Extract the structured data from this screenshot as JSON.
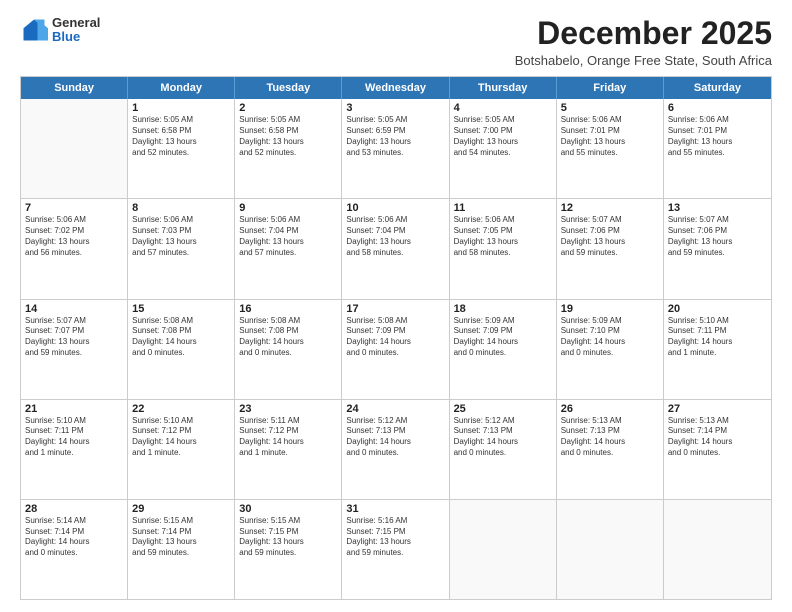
{
  "logo": {
    "general": "General",
    "blue": "Blue"
  },
  "title": "December 2025",
  "subtitle": "Botshabelo, Orange Free State, South Africa",
  "header_days": [
    "Sunday",
    "Monday",
    "Tuesday",
    "Wednesday",
    "Thursday",
    "Friday",
    "Saturday"
  ],
  "weeks": [
    [
      {
        "day": "",
        "lines": []
      },
      {
        "day": "1",
        "lines": [
          "Sunrise: 5:05 AM",
          "Sunset: 6:58 PM",
          "Daylight: 13 hours",
          "and 52 minutes."
        ]
      },
      {
        "day": "2",
        "lines": [
          "Sunrise: 5:05 AM",
          "Sunset: 6:58 PM",
          "Daylight: 13 hours",
          "and 52 minutes."
        ]
      },
      {
        "day": "3",
        "lines": [
          "Sunrise: 5:05 AM",
          "Sunset: 6:59 PM",
          "Daylight: 13 hours",
          "and 53 minutes."
        ]
      },
      {
        "day": "4",
        "lines": [
          "Sunrise: 5:05 AM",
          "Sunset: 7:00 PM",
          "Daylight: 13 hours",
          "and 54 minutes."
        ]
      },
      {
        "day": "5",
        "lines": [
          "Sunrise: 5:06 AM",
          "Sunset: 7:01 PM",
          "Daylight: 13 hours",
          "and 55 minutes."
        ]
      },
      {
        "day": "6",
        "lines": [
          "Sunrise: 5:06 AM",
          "Sunset: 7:01 PM",
          "Daylight: 13 hours",
          "and 55 minutes."
        ]
      }
    ],
    [
      {
        "day": "7",
        "lines": [
          "Sunrise: 5:06 AM",
          "Sunset: 7:02 PM",
          "Daylight: 13 hours",
          "and 56 minutes."
        ]
      },
      {
        "day": "8",
        "lines": [
          "Sunrise: 5:06 AM",
          "Sunset: 7:03 PM",
          "Daylight: 13 hours",
          "and 57 minutes."
        ]
      },
      {
        "day": "9",
        "lines": [
          "Sunrise: 5:06 AM",
          "Sunset: 7:04 PM",
          "Daylight: 13 hours",
          "and 57 minutes."
        ]
      },
      {
        "day": "10",
        "lines": [
          "Sunrise: 5:06 AM",
          "Sunset: 7:04 PM",
          "Daylight: 13 hours",
          "and 58 minutes."
        ]
      },
      {
        "day": "11",
        "lines": [
          "Sunrise: 5:06 AM",
          "Sunset: 7:05 PM",
          "Daylight: 13 hours",
          "and 58 minutes."
        ]
      },
      {
        "day": "12",
        "lines": [
          "Sunrise: 5:07 AM",
          "Sunset: 7:06 PM",
          "Daylight: 13 hours",
          "and 59 minutes."
        ]
      },
      {
        "day": "13",
        "lines": [
          "Sunrise: 5:07 AM",
          "Sunset: 7:06 PM",
          "Daylight: 13 hours",
          "and 59 minutes."
        ]
      }
    ],
    [
      {
        "day": "14",
        "lines": [
          "Sunrise: 5:07 AM",
          "Sunset: 7:07 PM",
          "Daylight: 13 hours",
          "and 59 minutes."
        ]
      },
      {
        "day": "15",
        "lines": [
          "Sunrise: 5:08 AM",
          "Sunset: 7:08 PM",
          "Daylight: 14 hours",
          "and 0 minutes."
        ]
      },
      {
        "day": "16",
        "lines": [
          "Sunrise: 5:08 AM",
          "Sunset: 7:08 PM",
          "Daylight: 14 hours",
          "and 0 minutes."
        ]
      },
      {
        "day": "17",
        "lines": [
          "Sunrise: 5:08 AM",
          "Sunset: 7:09 PM",
          "Daylight: 14 hours",
          "and 0 minutes."
        ]
      },
      {
        "day": "18",
        "lines": [
          "Sunrise: 5:09 AM",
          "Sunset: 7:09 PM",
          "Daylight: 14 hours",
          "and 0 minutes."
        ]
      },
      {
        "day": "19",
        "lines": [
          "Sunrise: 5:09 AM",
          "Sunset: 7:10 PM",
          "Daylight: 14 hours",
          "and 0 minutes."
        ]
      },
      {
        "day": "20",
        "lines": [
          "Sunrise: 5:10 AM",
          "Sunset: 7:11 PM",
          "Daylight: 14 hours",
          "and 1 minute."
        ]
      }
    ],
    [
      {
        "day": "21",
        "lines": [
          "Sunrise: 5:10 AM",
          "Sunset: 7:11 PM",
          "Daylight: 14 hours",
          "and 1 minute."
        ]
      },
      {
        "day": "22",
        "lines": [
          "Sunrise: 5:10 AM",
          "Sunset: 7:12 PM",
          "Daylight: 14 hours",
          "and 1 minute."
        ]
      },
      {
        "day": "23",
        "lines": [
          "Sunrise: 5:11 AM",
          "Sunset: 7:12 PM",
          "Daylight: 14 hours",
          "and 1 minute."
        ]
      },
      {
        "day": "24",
        "lines": [
          "Sunrise: 5:12 AM",
          "Sunset: 7:13 PM",
          "Daylight: 14 hours",
          "and 0 minutes."
        ]
      },
      {
        "day": "25",
        "lines": [
          "Sunrise: 5:12 AM",
          "Sunset: 7:13 PM",
          "Daylight: 14 hours",
          "and 0 minutes."
        ]
      },
      {
        "day": "26",
        "lines": [
          "Sunrise: 5:13 AM",
          "Sunset: 7:13 PM",
          "Daylight: 14 hours",
          "and 0 minutes."
        ]
      },
      {
        "day": "27",
        "lines": [
          "Sunrise: 5:13 AM",
          "Sunset: 7:14 PM",
          "Daylight: 14 hours",
          "and 0 minutes."
        ]
      }
    ],
    [
      {
        "day": "28",
        "lines": [
          "Sunrise: 5:14 AM",
          "Sunset: 7:14 PM",
          "Daylight: 14 hours",
          "and 0 minutes."
        ]
      },
      {
        "day": "29",
        "lines": [
          "Sunrise: 5:15 AM",
          "Sunset: 7:14 PM",
          "Daylight: 13 hours",
          "and 59 minutes."
        ]
      },
      {
        "day": "30",
        "lines": [
          "Sunrise: 5:15 AM",
          "Sunset: 7:15 PM",
          "Daylight: 13 hours",
          "and 59 minutes."
        ]
      },
      {
        "day": "31",
        "lines": [
          "Sunrise: 5:16 AM",
          "Sunset: 7:15 PM",
          "Daylight: 13 hours",
          "and 59 minutes."
        ]
      },
      {
        "day": "",
        "lines": []
      },
      {
        "day": "",
        "lines": []
      },
      {
        "day": "",
        "lines": []
      }
    ]
  ]
}
